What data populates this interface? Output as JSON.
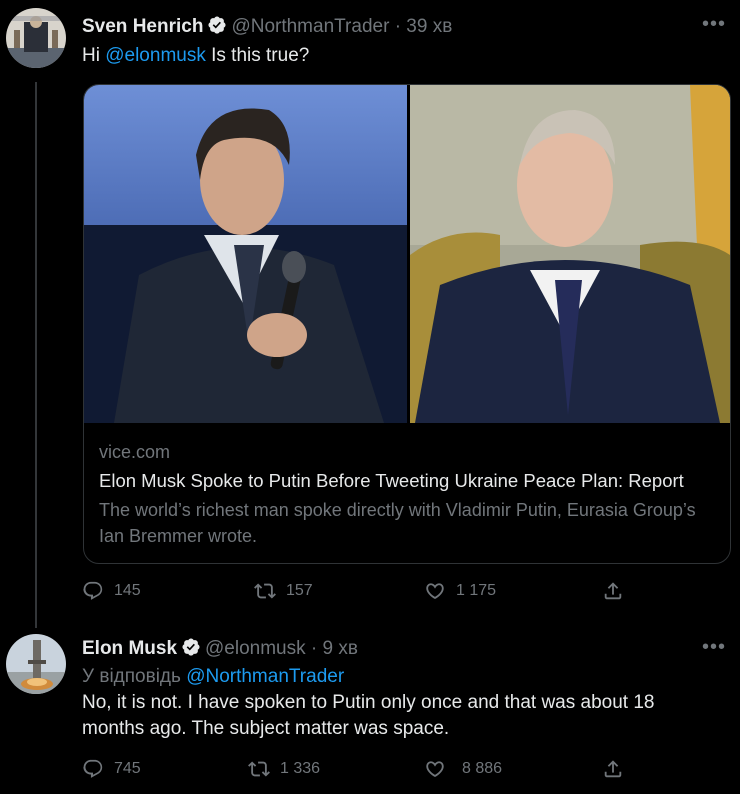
{
  "tweet1": {
    "display_name": "Sven Henrich",
    "handle": "@NorthmanTrader",
    "separator": "·",
    "time": "39 хв",
    "text_prefix": "Hi",
    "mention": "@elonmusk",
    "text_suffix": "Is this true?",
    "more": "•••",
    "card": {
      "domain": "vice.com",
      "title": "Elon Musk Spoke to Putin Before Tweeting Ukraine Peace Plan: Report",
      "description": "The world’s richest man spoke directly with Vladimir Putin, Eurasia Group’s Ian Bremmer wrote."
    },
    "actions": {
      "replies": "145",
      "retweets": "157",
      "likes": "1 175"
    }
  },
  "tweet2": {
    "display_name": "Elon Musk",
    "handle": "@elonmusk",
    "separator": "·",
    "time": "9 хв",
    "reply_prefix": "У відповідь",
    "reply_to": "@NorthmanTrader",
    "text": "No, it is not. I have spoken to Putin only once and that was about 18 months ago. The subject matter was space.",
    "more": "•••",
    "actions": {
      "replies": "745",
      "retweets": "1 336",
      "likes": "8 886"
    }
  },
  "colors": {
    "background": "#000000",
    "text": "#e7e9ea",
    "muted": "#71767b",
    "link": "#1d9bf0",
    "verified": "#1d9bf0"
  }
}
